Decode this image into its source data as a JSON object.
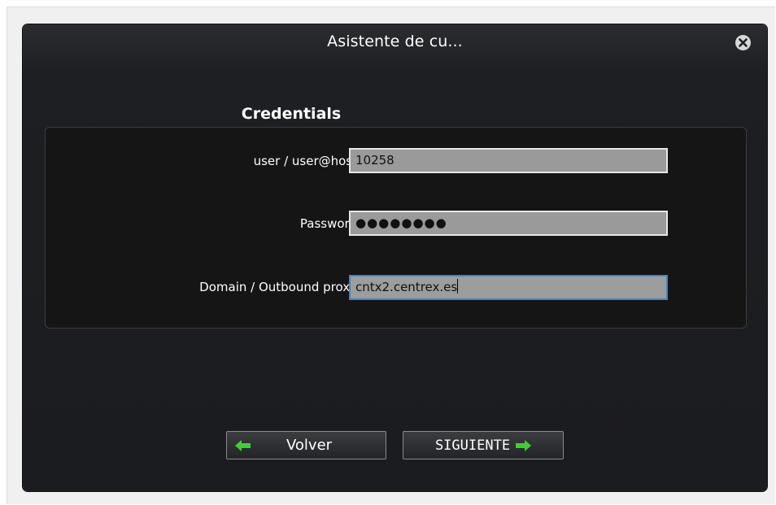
{
  "dialog": {
    "title": "Asistente de cu...",
    "section_title": "Credentials"
  },
  "fields": {
    "user": {
      "label": "user / user@host",
      "value": "10258"
    },
    "password": {
      "label": "Password",
      "masked_value": "●●●●●●●●"
    },
    "domain": {
      "label": "Domain / Outbound proxy",
      "value": "cntx2.centrex.es"
    }
  },
  "buttons": {
    "back_label": "Volver",
    "next_label": "SIGUIENTE"
  },
  "icons": {
    "close": "close-icon",
    "back": "arrow-left-icon",
    "next": "arrow-right-icon"
  },
  "colors": {
    "arrow_green": "#3fcf35",
    "focus_border": "#3e86c7"
  }
}
